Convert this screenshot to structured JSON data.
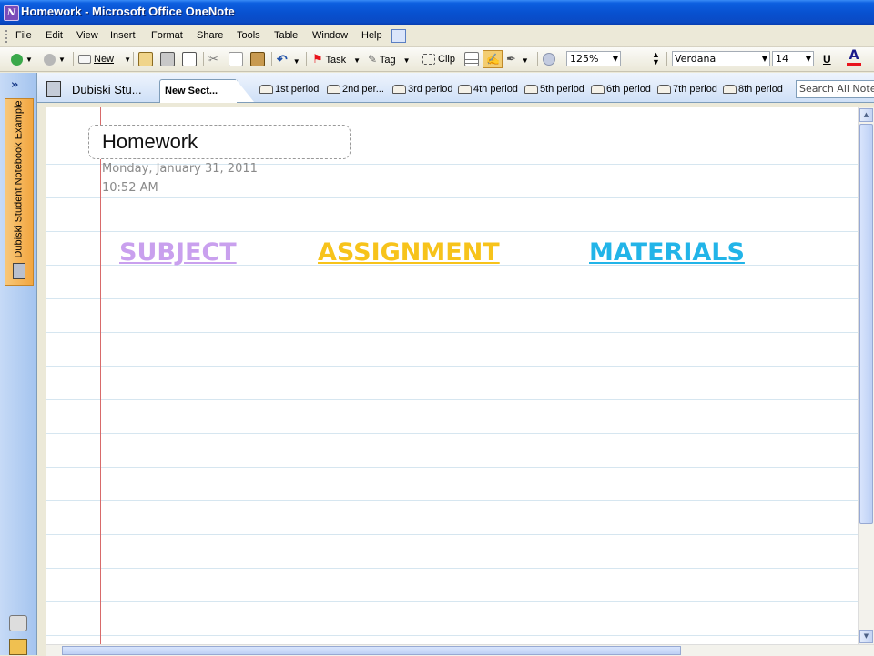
{
  "window": {
    "title": "Homework - Microsoft Office OneNote",
    "app_icon_letter": "N"
  },
  "menu": [
    "File",
    "Edit",
    "View",
    "Insert",
    "Format",
    "Share",
    "Tools",
    "Table",
    "Window",
    "Help"
  ],
  "toolbar": {
    "new_label": "New",
    "task_label": "Task",
    "tag_label": "Tag",
    "clip_label": "Clip",
    "zoom": "125%",
    "font": "Verdana",
    "font_size": "14",
    "underline_label": "U",
    "font_color_label": "A",
    "font_color": "#e8131b"
  },
  "nav": {
    "notebook_tab": "Dubiski Student Notebook Example",
    "collapse_label": "»"
  },
  "tabs": {
    "notebook": "Dubiski Stu...",
    "active_section": "New Sect...",
    "sections": [
      "1st period",
      "2nd per...",
      "3rd period",
      "4th period",
      "5th period",
      "6th period",
      "7th period",
      "8th period"
    ],
    "search_placeholder": "Search All Notebooks"
  },
  "page": {
    "title": "Homework",
    "date": "Monday, January 31, 2011",
    "time": "10:52 AM",
    "headings": [
      {
        "text": "SUBJECT",
        "color": "#c9a0ee"
      },
      {
        "text": "ASSIGNMENT",
        "color": "#f7c31b"
      },
      {
        "text": "MATERIALS",
        "color": "#22b4e8"
      }
    ]
  }
}
